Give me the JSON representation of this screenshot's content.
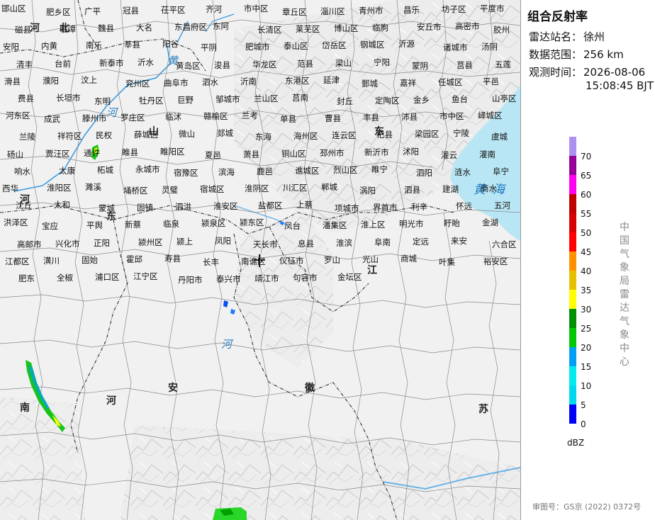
{
  "panel": {
    "title": "组合反射率",
    "station_key": "雷达站名：",
    "station_value": "徐州",
    "range_key": "数据范围：",
    "range_value": "256 km",
    "time_key": "观测时间：",
    "time_date": "2026-08-06",
    "time_clock": "15:08:45 BJT",
    "legend_unit": "dBZ",
    "agency": "中国气象局雷达气象中心",
    "review_no": "审图号：GS京 (2022) 0372号"
  },
  "legend": [
    {
      "value": "70",
      "color": "#ad90f0"
    },
    {
      "value": "65",
      "color": "#960096"
    },
    {
      "value": "60",
      "color": "#ff00f0"
    },
    {
      "value": "55",
      "color": "#c00000"
    },
    {
      "value": "50",
      "color": "#d60000"
    },
    {
      "value": "45",
      "color": "#ff0000"
    },
    {
      "value": "40",
      "color": "#ff9000"
    },
    {
      "value": "35",
      "color": "#e7c000"
    },
    {
      "value": "30",
      "color": "#ffff00"
    },
    {
      "value": "25",
      "color": "#009000"
    },
    {
      "value": "20",
      "color": "#00c800"
    },
    {
      "value": "15",
      "color": "#01a0f6"
    },
    {
      "value": "10",
      "color": "#00ecec"
    },
    {
      "value": "5",
      "color": "#00d8f0"
    },
    {
      "value": "0",
      "color": "#0000f6"
    }
  ],
  "map": {
    "sea_label": "黄海",
    "river_labels": [
      "黄",
      "河",
      "河"
    ],
    "province_labels": [
      "河",
      "北",
      "山",
      "东",
      "河",
      "南",
      "江",
      "安",
      "徽",
      "苏",
      "东",
      "河"
    ],
    "place_labels": [
      "邯山区",
      "肥乡区",
      "广平",
      "冠县",
      "茌平区",
      "齐河",
      "市中区",
      "章丘区",
      "淄川区",
      "青州市",
      "昌乐",
      "坊子区",
      "平度市",
      "磁县",
      "临漳",
      "魏县",
      "大名",
      "东昌府区",
      "东阿",
      "长清区",
      "莱芜区",
      "博山区",
      "临朐",
      "安丘市",
      "高密市",
      "胶州",
      "安阳",
      "内黄",
      "南乐",
      "莘县",
      "阳谷",
      "平阴",
      "肥城市",
      "泰山区",
      "岱岳区",
      "钢城区",
      "沂源",
      "诸城市",
      "汤阴",
      "清丰",
      "台前",
      "新泰市",
      "沂水",
      "黄岛区",
      "浚县",
      "华龙区",
      "范县",
      "梁山",
      "宁阳",
      "蒙阴",
      "莒县",
      "五莲",
      "滑县",
      "濮阳",
      "汶上",
      "兖州区",
      "曲阜市",
      "泗水",
      "沂南",
      "东港区",
      "延津",
      "鄄城",
      "嘉祥",
      "任城区",
      "平邑",
      "费县",
      "长垣市",
      "东明",
      "牡丹区",
      "巨野",
      "邹城市",
      "兰山区",
      "莒南",
      "封丘",
      "定陶区",
      "金乡",
      "鱼台",
      "山亭区",
      "河东区",
      "成武",
      "滕州市",
      "罗庄区",
      "临沭",
      "赣榆区",
      "兰考",
      "单县",
      "曹县",
      "丰县",
      "沛县",
      "市中区",
      "峄城区",
      "兰陵",
      "祥符区",
      "民权",
      "薛城区",
      "微山",
      "郯城",
      "东海",
      "海州区",
      "连云区",
      "杞县",
      "梁园区",
      "宁陵",
      "虞城",
      "砀山",
      "贾汪区",
      "通许",
      "睢县",
      "睢阳区",
      "夏邑",
      "萧县",
      "铜山区",
      "邳州市",
      "新沂市",
      "沭阳",
      "灌云",
      "灌南",
      "响水",
      "太康",
      "柘城",
      "永城市",
      "宿豫区",
      "滨海",
      "鹿邑",
      "谯城区",
      "烈山区",
      "睢宁",
      "泗阳",
      "涟水",
      "阜宁",
      "西华",
      "淮阳区",
      "濉溪",
      "埇桥区",
      "灵璧",
      "宿城区",
      "淮阴区",
      "川汇区",
      "郸城",
      "涡阳",
      "泗县",
      "建湖",
      "商水",
      "沈丘",
      "太和",
      "蒙城",
      "固镇",
      "泗洪",
      "淮安区",
      "盐都区",
      "上蔡",
      "项城市",
      "界首市",
      "利辛",
      "怀远",
      "五河",
      "洪泽区",
      "宝应",
      "平舆",
      "新蔡",
      "临泉",
      "颍泉区",
      "颍东区",
      "凤台",
      "潘集区",
      "淮上区",
      "明光市",
      "盱眙",
      "金湖",
      "高邮市",
      "兴化市",
      "正阳",
      "颍州区",
      "颍上",
      "凤阳",
      "天长市",
      "息县",
      "淮滨",
      "阜南",
      "定远",
      "来安",
      "六合区",
      "江都区",
      "潢川",
      "固始",
      "霍邱",
      "寿县",
      "长丰",
      "南谯区",
      "仪征市",
      "罗山",
      "光山",
      "商城",
      "叶集",
      "裕安区",
      "肥东",
      "全椒",
      "浦口区",
      "江宁区",
      "丹阳市",
      "泰兴市",
      "靖江市",
      "句容市",
      "金坛区"
    ]
  }
}
